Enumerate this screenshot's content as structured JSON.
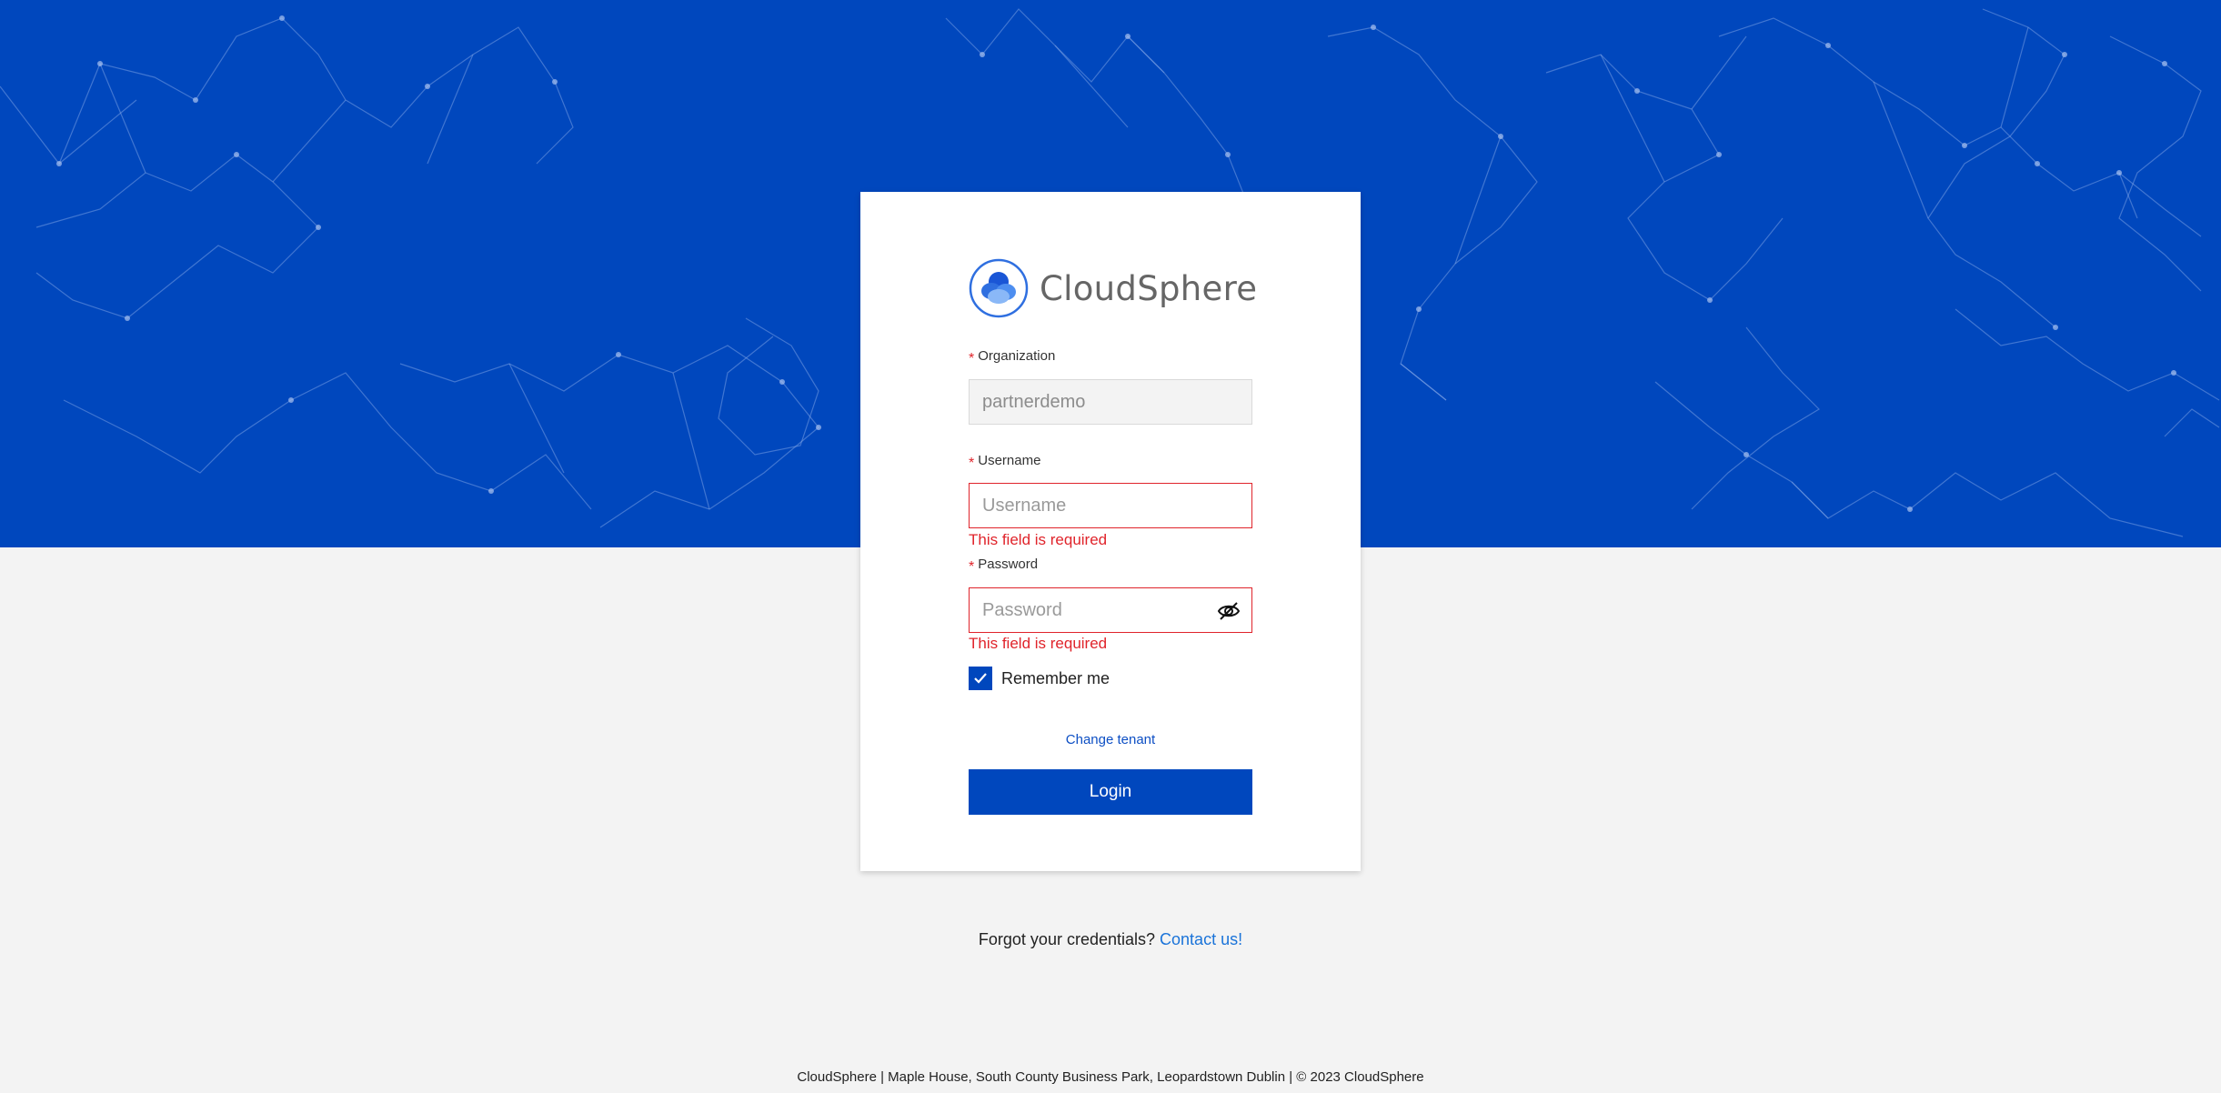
{
  "brand": {
    "name": "CloudSphere",
    "logo_icon": "cloud-sphere-logo-icon"
  },
  "form": {
    "organization": {
      "label": "Organization",
      "value": "partnerdemo",
      "required_mark": "*"
    },
    "username": {
      "label": "Username",
      "placeholder": "Username",
      "required_mark": "*",
      "error": "This field is required"
    },
    "password": {
      "label": "Password",
      "placeholder": "Password",
      "required_mark": "*",
      "error": "This field is required",
      "toggle_icon": "eye-slash-icon"
    },
    "remember": {
      "label": "Remember me",
      "checked": true
    },
    "change_tenant": "Change tenant",
    "login_label": "Login"
  },
  "help": {
    "prompt": "Forgot your credentials?",
    "link": "Contact us!"
  },
  "footer": {
    "text": "CloudSphere | Maple House, South County Business Park, Leopardstown Dublin | © 2023 CloudSphere"
  },
  "colors": {
    "primary": "#0047bd",
    "error": "#e0242b",
    "link": "#1a73d9",
    "background": "#f3f3f3"
  }
}
